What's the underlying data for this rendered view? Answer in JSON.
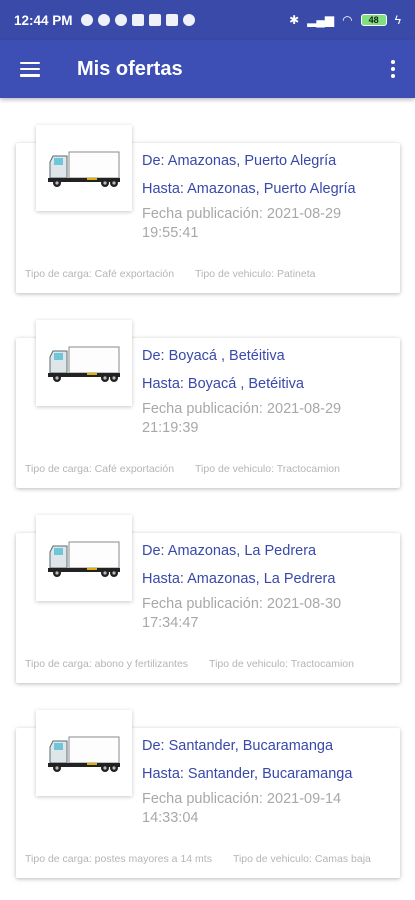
{
  "status": {
    "time": "12:44 PM",
    "battery": "48",
    "notification_icons": [
      "message-icon",
      "facebook-icon",
      "threads-icon",
      "gallery-icon",
      "cloud-icon",
      "app-icon",
      "telegram-icon"
    ]
  },
  "appbar": {
    "title": "Mis ofertas"
  },
  "offers": [
    {
      "from": "De: Amazonas, Puerto Alegría",
      "to": "Hasta: Amazonas,  Puerto Alegría",
      "date_label": "Fecha publicación: 2021-08-29 19:55:41",
      "cargo": "Tipo de carga: Café exportación",
      "vehicle": "Tipo de vehiculo: Patineta"
    },
    {
      "from": "De: Boyacá , Betéitiva",
      "to": "Hasta: Boyacá ,  Betéitiva",
      "date_label": "Fecha publicación: 2021-08-29 21:19:39",
      "cargo": "Tipo de carga: Café exportación",
      "vehicle": "Tipo de vehiculo: Tractocamion"
    },
    {
      "from": "De: Amazonas, La Pedrera",
      "to": "Hasta: Amazonas,  La Pedrera",
      "date_label": "Fecha publicación: 2021-08-30 17:34:47",
      "cargo": "Tipo de carga: abono y fertilizantes",
      "vehicle": "Tipo de vehiculo: Tractocamion"
    },
    {
      "from": "De: Santander, Bucaramanga",
      "to": "Hasta: Santander,  Bucaramanga",
      "date_label": "Fecha publicación: 2021-09-14 14:33:04",
      "cargo": "Tipo de carga: postes mayores a 14 mts",
      "vehicle": "Tipo de vehiculo: Camas baja"
    }
  ],
  "colors": {
    "appbar": "#3d4fb5",
    "statusbar": "#3a4aa8",
    "link_text": "#3949ab",
    "muted_text": "#a8a8a8"
  }
}
